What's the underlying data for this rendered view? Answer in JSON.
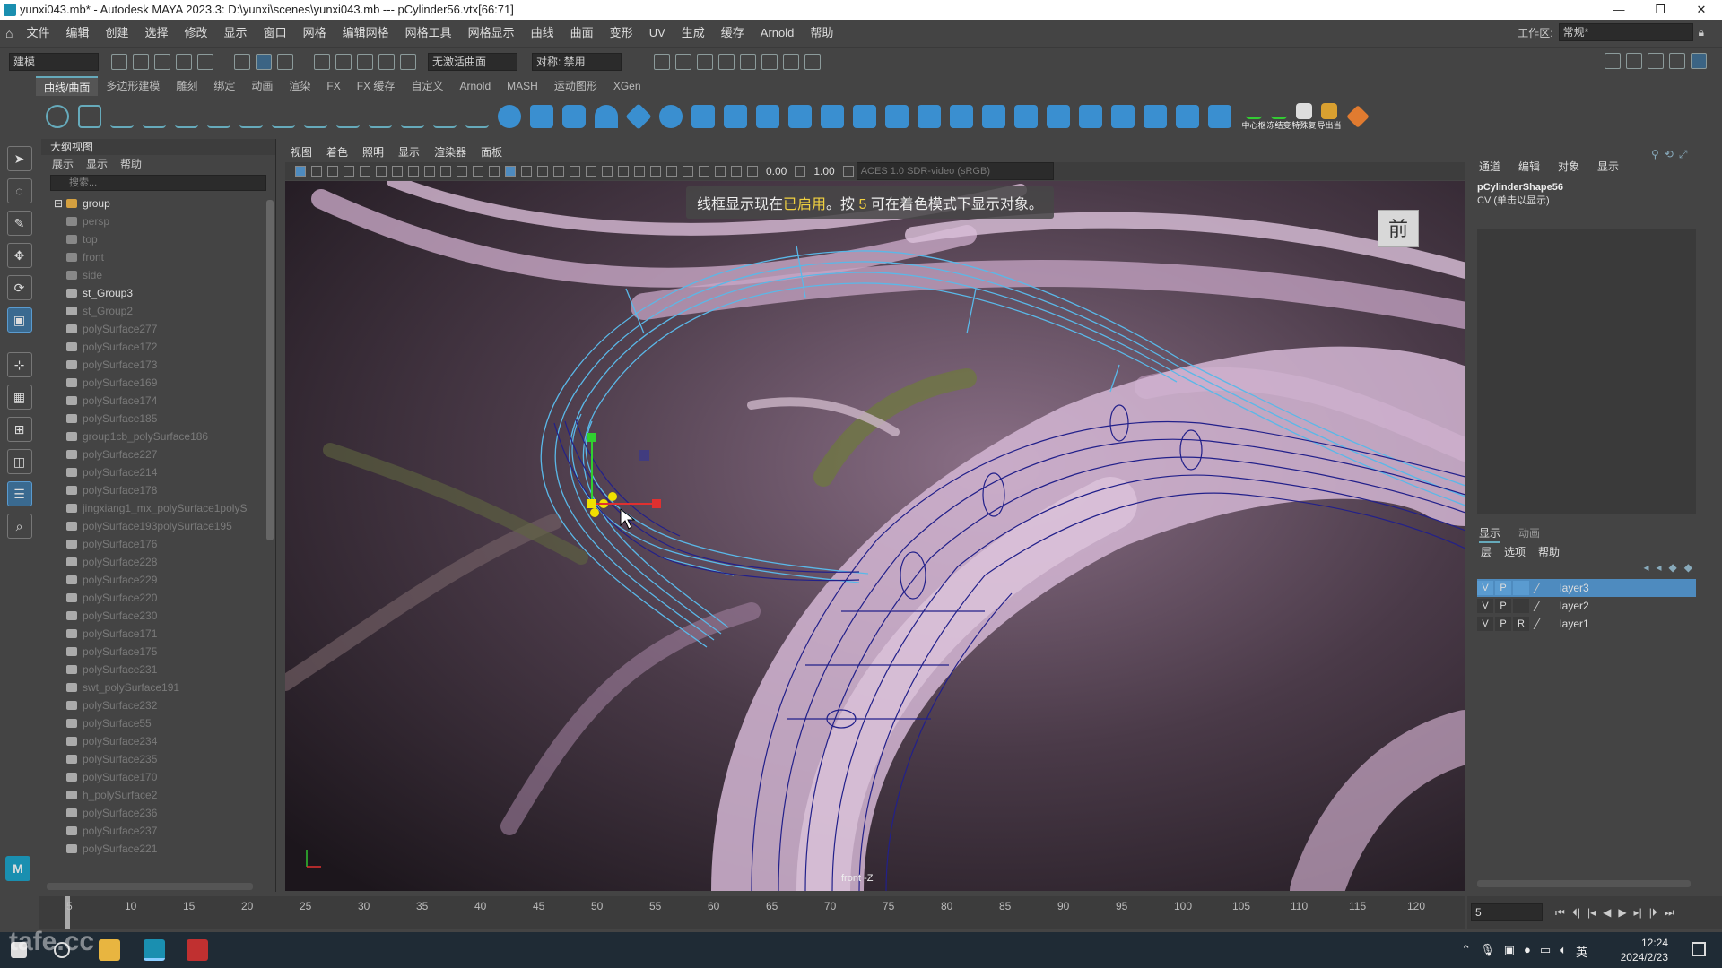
{
  "titlebar": {
    "title": "yunxi043.mb* - Autodesk MAYA 2023.3: D:\\yunxi\\scenes\\yunxi043.mb   ---   pCylinder56.vtx[66:71]"
  },
  "menubar": {
    "items": [
      "文件",
      "编辑",
      "创建",
      "选择",
      "修改",
      "显示",
      "窗口",
      "网格",
      "编辑网格",
      "网格工具",
      "网格显示",
      "曲线",
      "曲面",
      "变形",
      "UV",
      "生成",
      "缓存",
      "Arnold",
      "帮助"
    ],
    "workspace_label": "工作区:",
    "workspace_value": "常规*"
  },
  "statusline": {
    "mode": "建模",
    "live_surface": "无激活曲面",
    "symmetry": "对称: 禁用"
  },
  "shelf": {
    "tabs": [
      "曲线/曲面",
      "多边形建模",
      "雕刻",
      "绑定",
      "动画",
      "渲染",
      "FX",
      "FX 缓存",
      "自定义",
      "Arnold",
      "MASH",
      "运动图形",
      "XGen"
    ],
    "active_tab": 0,
    "end_labels": [
      "中心枢",
      "冻结变",
      "特殊复",
      "导出当"
    ]
  },
  "outliner": {
    "title": "大纲视图",
    "menu": [
      "展示",
      "显示",
      "帮助"
    ],
    "search_placeholder": "搜索...",
    "items": [
      "group",
      "persp",
      "top",
      "front",
      "side",
      "st_Group3",
      "st_Group2",
      "polySurface277",
      "polySurface172",
      "polySurface173",
      "polySurface169",
      "polySurface174",
      "polySurface185",
      "group1cb_polySurface186",
      "polySurface227",
      "polySurface214",
      "polySurface178",
      "jingxiang1_mx_polySurface1polyS",
      "polySurface193polySurface195",
      "polySurface176",
      "polySurface228",
      "polySurface229",
      "polySurface220",
      "polySurface230",
      "polySurface171",
      "polySurface175",
      "polySurface231",
      "swt_polySurface191",
      "polySurface232",
      "polySurface55",
      "polySurface234",
      "polySurface235",
      "polySurface170",
      "h_polySurface2",
      "polySurface236",
      "polySurface237",
      "polySurface221"
    ]
  },
  "viewport": {
    "menu": [
      "视图",
      "着色",
      "照明",
      "显示",
      "渲染器",
      "面板"
    ],
    "near": "0.00",
    "far": "1.00",
    "colorspace": "ACES 1.0 SDR-video (sRGB)",
    "hud_prefix": "线框显示现在",
    "hud_highlight": "已启用",
    "hud_mid": "。按",
    "hud_key": "5",
    "hud_suffix": "可在着色模式下显示对象。",
    "viewcube_label": "前",
    "camera_label": "front -Z"
  },
  "channelbox": {
    "tabs": [
      "通道",
      "编辑",
      "对象",
      "显示"
    ],
    "object": "pCylinderShape56",
    "subtitle": "CV (单击以显示)"
  },
  "layers": {
    "tabs": [
      "显示",
      "动画"
    ],
    "menu": [
      "层",
      "选项",
      "帮助"
    ],
    "rows": [
      {
        "v": "V",
        "p": "P",
        "r": "",
        "name": "layer3",
        "selected": true
      },
      {
        "v": "V",
        "p": "P",
        "r": "",
        "name": "layer2",
        "selected": false
      },
      {
        "v": "V",
        "p": "P",
        "r": "R",
        "name": "layer1",
        "selected": false
      }
    ]
  },
  "timeline": {
    "ticks": [
      "5",
      "10",
      "15",
      "20",
      "25",
      "30",
      "35",
      "40",
      "45",
      "50",
      "55",
      "60",
      "65",
      "70",
      "75",
      "80",
      "85",
      "90",
      "95",
      "100",
      "105",
      "110",
      "115",
      "120"
    ],
    "current_frame": "5"
  },
  "taskbar": {
    "time": "12:24",
    "date": "2024/2/23",
    "ime": "英"
  },
  "watermark": "tafe.cc"
}
